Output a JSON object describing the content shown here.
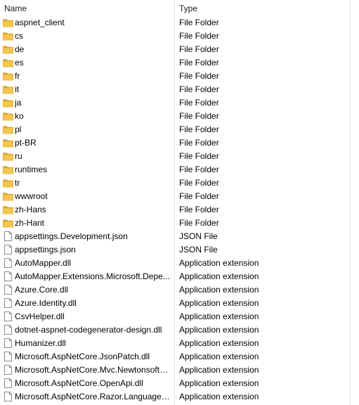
{
  "columns": {
    "name": "Name",
    "type": "Type",
    "sort_indicator": "^"
  },
  "colors": {
    "folder": "#f4c84f",
    "folder_dark": "#dca52c",
    "file_border": "#8a8a8a",
    "separator": "#e5e5e5"
  },
  "rows": [
    {
      "name": "aspnet_client",
      "type": "File Folder",
      "icon": "folder-icon"
    },
    {
      "name": "cs",
      "type": "File Folder",
      "icon": "folder-icon"
    },
    {
      "name": "de",
      "type": "File Folder",
      "icon": "folder-icon"
    },
    {
      "name": "es",
      "type": "File Folder",
      "icon": "folder-icon"
    },
    {
      "name": "fr",
      "type": "File Folder",
      "icon": "folder-icon"
    },
    {
      "name": "it",
      "type": "File Folder",
      "icon": "folder-icon"
    },
    {
      "name": "ja",
      "type": "File Folder",
      "icon": "folder-icon"
    },
    {
      "name": "ko",
      "type": "File Folder",
      "icon": "folder-icon"
    },
    {
      "name": "pl",
      "type": "File Folder",
      "icon": "folder-icon"
    },
    {
      "name": "pt-BR",
      "type": "File Folder",
      "icon": "folder-icon"
    },
    {
      "name": "ru",
      "type": "File Folder",
      "icon": "folder-icon"
    },
    {
      "name": "runtimes",
      "type": "File Folder",
      "icon": "folder-icon"
    },
    {
      "name": "tr",
      "type": "File Folder",
      "icon": "folder-icon"
    },
    {
      "name": "wwwroot",
      "type": "File Folder",
      "icon": "folder-icon"
    },
    {
      "name": "zh-Hans",
      "type": "File Folder",
      "icon": "folder-icon"
    },
    {
      "name": "zh-Hant",
      "type": "File Folder",
      "icon": "folder-icon"
    },
    {
      "name": "appsettings.Development.json",
      "type": "JSON File",
      "icon": "file-icon"
    },
    {
      "name": "appsettings.json",
      "type": "JSON File",
      "icon": "file-icon"
    },
    {
      "name": "AutoMapper.dll",
      "type": "Application extension",
      "icon": "file-icon"
    },
    {
      "name": "AutoMapper.Extensions.Microsoft.Depe...",
      "type": "Application extension",
      "icon": "file-icon"
    },
    {
      "name": "Azure.Core.dll",
      "type": "Application extension",
      "icon": "file-icon"
    },
    {
      "name": "Azure.Identity.dll",
      "type": "Application extension",
      "icon": "file-icon"
    },
    {
      "name": "CsvHelper.dll",
      "type": "Application extension",
      "icon": "file-icon"
    },
    {
      "name": "dotnet-aspnet-codegenerator-design.dll",
      "type": "Application extension",
      "icon": "file-icon"
    },
    {
      "name": "Humanizer.dll",
      "type": "Application extension",
      "icon": "file-icon"
    },
    {
      "name": "Microsoft.AspNetCore.JsonPatch.dll",
      "type": "Application extension",
      "icon": "file-icon"
    },
    {
      "name": "Microsoft.AspNetCore.Mvc.NewtonsoftJ...",
      "type": "Application extension",
      "icon": "file-icon"
    },
    {
      "name": "Microsoft.AspNetCore.OpenApi.dll",
      "type": "Application extension",
      "icon": "file-icon"
    },
    {
      "name": "Microsoft.AspNetCore.Razor.Language.dll",
      "type": "Application extension",
      "icon": "file-icon"
    }
  ]
}
